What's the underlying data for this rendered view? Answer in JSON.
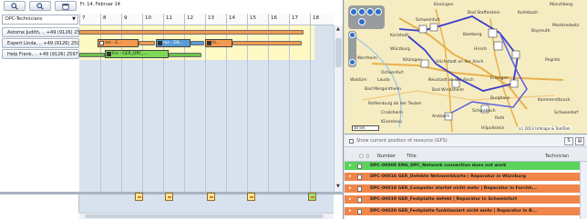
{
  "toolbar": {
    "date": "Fr. 14. Februar 14"
  },
  "filter": {
    "selected": "DPC-Technicians"
  },
  "timeline": {
    "hours": [
      "7",
      "8",
      "9",
      "10",
      "11",
      "12",
      "13",
      "14",
      "15",
      "16",
      "17",
      "18"
    ]
  },
  "resources": [
    {
      "label": "Astome Judith, .. +49 (9126) 259"
    },
    {
      "label": "Expert Linda, .. +49 (9126) 2597"
    },
    {
      "label": "Help Frank, .. +49 (9126) 25979"
    }
  ],
  "tasks": [
    {
      "label": "res - E..."
    },
    {
      "label": "res - EN..."
    },
    {
      "label": "In..."
    },
    {
      "label": "Fre - GER_DPC_..."
    }
  ],
  "map": {
    "labels": [
      "Kissingen",
      "Münchberg",
      "Bad Staffelstein",
      "Kulmbach",
      "Schweinfurt",
      "Karlstadt",
      "Bamberg",
      "Bayreuth",
      "Marktredwitz",
      "Würzburg",
      "Hirsch",
      "Kitzingen",
      "Höchstadt an der Aisch",
      "Ochsenfurt",
      "Pegnitz",
      "Waldürn",
      "Lauda",
      "Neustadt an der Aisch",
      "Erlangen",
      "Bad Mergentheim",
      "Bad Windsheim",
      "Rothenburg ob der Tauber",
      "Burghaus",
      "Kommerstbruck",
      "Schwandorf",
      "Crailsheim",
      "Schwabach",
      "Ansbach",
      "Roth",
      "Künzelsau",
      "Hilpoltstein",
      "Wertheim"
    ],
    "scale": "30 km",
    "copyright": "(c) 2013 Urlmaps & TomTom"
  },
  "gps": {
    "label": "Show current position of resource (GPS)"
  },
  "table": {
    "headers": {
      "number": "Number",
      "title": "Title",
      "technician": "Technician"
    },
    "rows": [
      {
        "text": "DPC-00008 ENG_DPC_Network connection does not work",
        "color": "#5bd35b"
      },
      {
        "text": "DPC-00016 GER_Defekte Netzwerkkarte | Reparatur in Würzburg",
        "color": "#f0864a"
      },
      {
        "text": "DPC-00018 GER_Computer startet nicht mehr | Reparatur in Forchh...",
        "color": "#f0864a"
      },
      {
        "text": "DPC-00019 GER_Festplatte defekt | Reparatur in Schweinfurt",
        "color": "#f0864a"
      },
      {
        "text": "DPC-00020 GER_Festplatte funktioniert nicht mehr | Reparatur in B...",
        "color": "#f0864a"
      }
    ]
  }
}
